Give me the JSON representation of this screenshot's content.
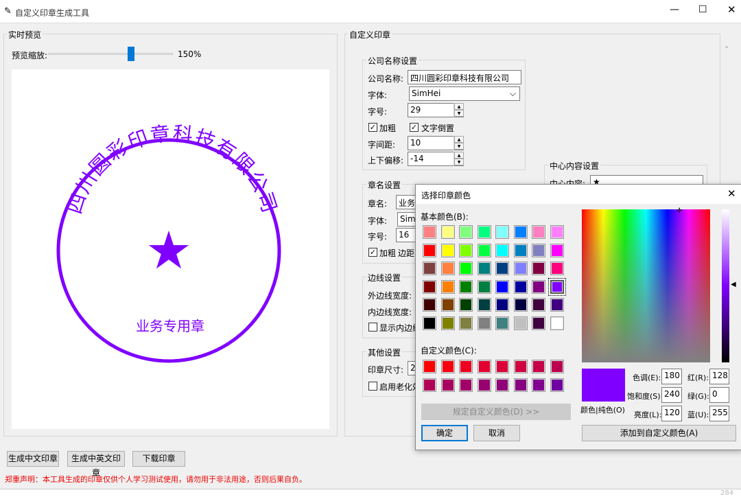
{
  "window": {
    "title": "自定义印章生成工具"
  },
  "preview": {
    "group_label": "实时预览",
    "zoom_label": "预览缩放:",
    "zoom_value": "150%",
    "zoom_percent": 150,
    "seal": {
      "company": "四川圆彩印章科技有限公司",
      "center": "★",
      "name": "业务专用章",
      "color": "#8000FF"
    }
  },
  "custom": {
    "group_label": "自定义印章",
    "company": {
      "label": "公司名称设置",
      "name_label": "公司名称:",
      "name_value": "四川圆彩印章科技有限公司",
      "font_label": "字体:",
      "font_value": "SimHei",
      "size_label": "字号:",
      "size_value": "29",
      "bold_label": "加粗",
      "bold_checked": true,
      "invert_label": "文字倒置",
      "invert_checked": true,
      "spacing_label": "字间距:",
      "spacing_value": "10",
      "offset_label": "上下偏移:",
      "offset_value": "-14"
    },
    "seal_name": {
      "label": "章名设置",
      "name_label": "章名:",
      "name_value": "业务专",
      "font_label": "字体:",
      "font_value": "SimH",
      "size_label": "字号:",
      "size_value": "16",
      "bold_label": "加粗",
      "bold_checked": true,
      "margin_label": "边距"
    },
    "border": {
      "label": "边线设置",
      "outer_label": "外边线宽度:",
      "inner_label": "内边线宽度:",
      "show_inner_label": "显示内边线",
      "show_inner_checked": false
    },
    "other": {
      "label": "其他设置",
      "size_label": "印章尺寸:",
      "size_value": "2",
      "aging_label": "启用老化效",
      "aging_checked": false
    },
    "center": {
      "label": "中心内容设置",
      "content_label": "中心内容:",
      "content_value": "★"
    }
  },
  "buttons": {
    "gen_cn": "生成中文印章",
    "gen_cn_en": "生成中英文印章",
    "download": "下载印章"
  },
  "disclaimer": "郑重声明：本工具生成的印章仅供个人学习测试使用，请勿用于非法用途，否则后果自负。",
  "dialog": {
    "title": "选择印章颜色",
    "basic_label": "基本颜色(B):",
    "custom_label": "自定义颜色(C):",
    "define_custom": "规定自定义颜色(D) >>",
    "ok": "确定",
    "cancel": "取消",
    "color_solid_label": "颜色|纯色(O)",
    "add_custom": "添加到自定义颜色(A)",
    "hue_label": "色调(E):",
    "hue": "180",
    "sat_label": "饱和度(S):",
    "sat": "240",
    "lum_label": "亮度(L):",
    "lum": "120",
    "red_label": "红(R):",
    "red": "128",
    "green_label": "绿(G):",
    "green": "0",
    "blue_label": "蓝(U):",
    "blue": "255",
    "current_color": "#8000FF",
    "basic_colors": [
      "#FF8080",
      "#FFFF80",
      "#80FF80",
      "#00FF80",
      "#80FFFF",
      "#0080FF",
      "#FF80C0",
      "#FF80FF",
      "#FF0000",
      "#FFFF00",
      "#80FF00",
      "#00FF40",
      "#00FFFF",
      "#0080C0",
      "#8080C0",
      "#FF00FF",
      "#804040",
      "#FF8040",
      "#00FF00",
      "#008080",
      "#004080",
      "#8080FF",
      "#800040",
      "#FF0080",
      "#800000",
      "#FF8000",
      "#008000",
      "#008040",
      "#0000FF",
      "#0000A0",
      "#800080",
      "#8000FF",
      "#400000",
      "#804000",
      "#004000",
      "#004040",
      "#000080",
      "#000040",
      "#400040",
      "#400080",
      "#000000",
      "#808000",
      "#808040",
      "#808080",
      "#408080",
      "#C0C0C0",
      "#400040",
      "#FFFFFF"
    ],
    "selected_basic": "#8000FF",
    "custom_colors": [
      "#FF0000",
      "#F70010",
      "#EE0020",
      "#E40030",
      "#DA0038",
      "#D00040",
      "#C60048",
      "#BC0050",
      "#B00058",
      "#A80060",
      "#A00068",
      "#980070",
      "#900078",
      "#880080",
      "#800090",
      "#7000A0"
    ]
  },
  "statusbar": {
    "text": "284"
  }
}
